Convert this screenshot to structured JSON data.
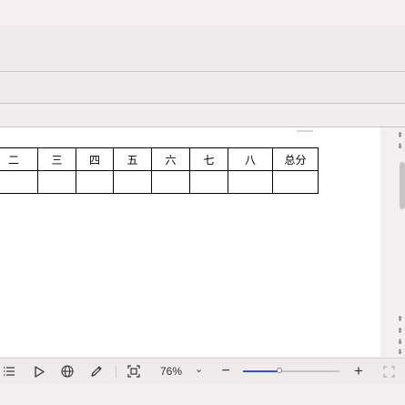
{
  "table": {
    "headers": [
      "二",
      "三",
      "四",
      "五",
      "六",
      "七",
      "八",
      "总分"
    ],
    "rows": [
      [
        "",
        "",
        "",
        "",
        "",
        "",
        "",
        ""
      ]
    ]
  },
  "statusbar": {
    "zoom": "76%",
    "zoom_caret": "⌄",
    "minus": "−",
    "plus": "+",
    "zoom_slider_level": 0.38
  },
  "scrollbar": {
    "up": "⇞",
    "down": "⇟"
  }
}
